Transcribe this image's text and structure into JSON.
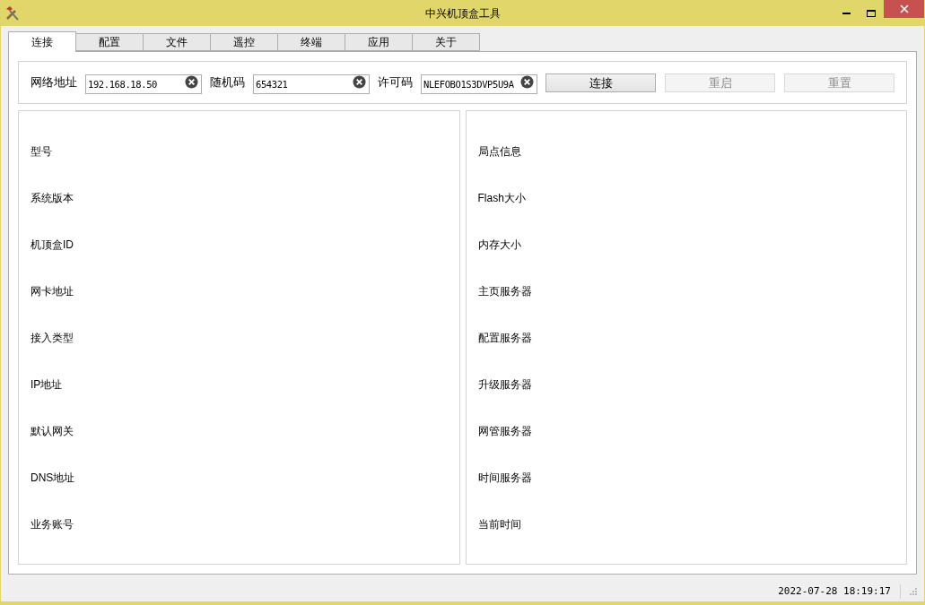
{
  "window": {
    "title": "中兴机顶盒工具"
  },
  "tabs": [
    {
      "label": "连接",
      "selected": true
    },
    {
      "label": "配置",
      "selected": false
    },
    {
      "label": "文件",
      "selected": false
    },
    {
      "label": "遥控",
      "selected": false
    },
    {
      "label": "终端",
      "selected": false
    },
    {
      "label": "应用",
      "selected": false
    },
    {
      "label": "关于",
      "selected": false
    }
  ],
  "fields": [
    {
      "label": "网络地址",
      "value": "192.168.18.50"
    },
    {
      "label": "随机码",
      "value": "654321"
    },
    {
      "label": "许可码",
      "value": "NLEFOBO1S3DVP5U9A"
    }
  ],
  "buttons": [
    {
      "label": "连接",
      "disabled": false
    },
    {
      "label": "重启",
      "disabled": true
    },
    {
      "label": "重置",
      "disabled": true
    }
  ],
  "left_panel": [
    "型号",
    "系统版本",
    "机顶盒ID",
    "网卡地址",
    "接入类型",
    "IP地址",
    "默认网关",
    "DNS地址",
    "业务账号"
  ],
  "right_panel": [
    "局点信息",
    "Flash大小",
    "内存大小",
    "主页服务器",
    "配置服务器",
    "升级服务器",
    "网管服务器",
    "时间服务器",
    "当前时间"
  ],
  "status_bar": {
    "time": "2022-07-28 18:19:17"
  }
}
